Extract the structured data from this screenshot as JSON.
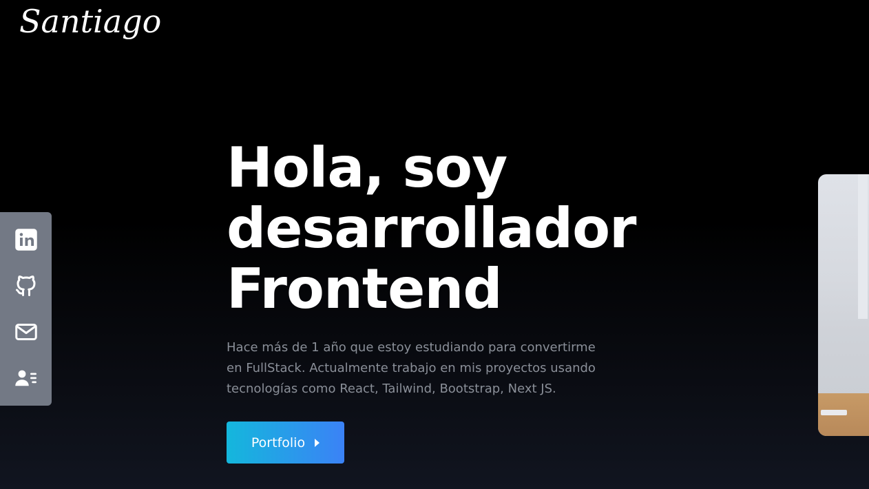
{
  "brand": {
    "logo_text": "Santiago"
  },
  "social": {
    "items": [
      {
        "label": "LinkedIn",
        "icon": "linkedin-icon"
      },
      {
        "label": "GitHub",
        "icon": "github-icon"
      },
      {
        "label": "Email",
        "icon": "mail-icon"
      },
      {
        "label": "Curriculum",
        "icon": "contact-card-icon"
      }
    ]
  },
  "hero": {
    "title_line1": "Hola, soy",
    "title_line2": "desarrollador",
    "title_line3": "Frontend",
    "description": "Hace más de 1 año que estoy estudiando para convertirme en FullStack. Actualmente trabajo en mis proyectos usando tecnologías como React, Tailwind, Bootstrap, Next JS.",
    "cta_label": "Portfolio"
  },
  "colors": {
    "background": "#000000",
    "social_bar": "#737985",
    "text_muted": "#8a8f98",
    "cta_gradient_start": "#14b7dc",
    "cta_gradient_end": "#3b82f6"
  }
}
